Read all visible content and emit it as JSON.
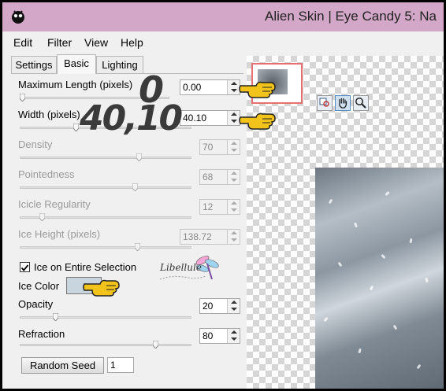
{
  "window": {
    "title": "Alien Skin | Eye Candy 5: Na"
  },
  "menu": {
    "edit": "Edit",
    "filter": "Filter",
    "view": "View",
    "help": "Help"
  },
  "tabs": {
    "settings": "Settings",
    "basic": "Basic",
    "lighting": "Lighting",
    "active": "Basic"
  },
  "params": {
    "max_length": {
      "label": "Maximum Length (pixels)",
      "value": "0.00",
      "slider": 0.0
    },
    "width": {
      "label": "Width (pixels)",
      "value": "40.10",
      "slider": 0.32
    },
    "density": {
      "label": "Density",
      "value": "70",
      "slider": 0.7
    },
    "pointedness": {
      "label": "Pointedness",
      "value": "68",
      "slider": 0.68
    },
    "icicle_regularity": {
      "label": "Icicle Regularity",
      "value": "12",
      "slider": 0.12
    },
    "ice_height": {
      "label": "Ice Height (pixels)",
      "value": "138.72",
      "slider": 0.69
    },
    "ice_on_entire_selection": {
      "label": "Ice on Entire Selection",
      "checked": true
    },
    "ice_color": {
      "label": "Ice Color",
      "color": "#c8d4de"
    },
    "opacity": {
      "label": "Opacity",
      "value": "20",
      "slider": 0.2
    },
    "refraction": {
      "label": "Refraction",
      "value": "80",
      "slider": 0.8
    }
  },
  "random_seed": {
    "label": "Random Seed",
    "value": "1"
  },
  "annotations": {
    "max_length_callout": "0",
    "width_callout": "40,10",
    "watermark": "Libellule"
  },
  "colors": {
    "titlebar": "#d3a7c7",
    "navigator_border": "#e87070"
  },
  "tools": [
    "zoom-toggle-icon",
    "hand-icon",
    "magnifier-icon"
  ]
}
